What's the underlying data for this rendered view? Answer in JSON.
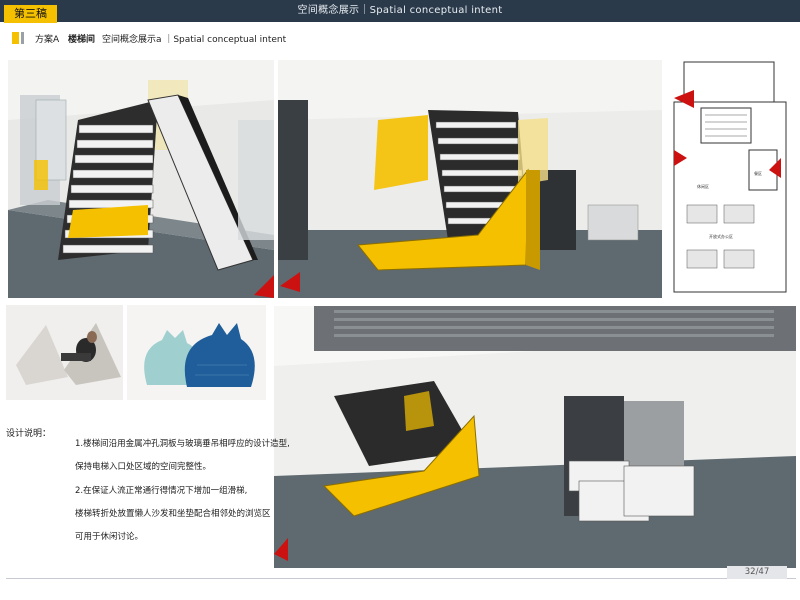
{
  "header": {
    "badge": "第三稿",
    "title": "空间概念展示｜Spatial  conceptual  intent"
  },
  "subheader": {
    "scheme": "方案A",
    "section": "楼梯间",
    "caption": "空间概念展示a ｜Spatial  conceptual  intent"
  },
  "description": {
    "heading": "设计说明：",
    "lines": [
      "1.楼梯间沿用金属冲孔洞板与玻璃垂吊相呼应的设计造型,",
      "保持电梯入口处区域的空间完整性。",
      "2.在保证人流正常通行得情况下增加一组滑梯,",
      "楼梯转折处放置懒人沙发和坐垫配合相邻处的浏览区",
      "可用于休闲讨论。"
    ]
  },
  "plan_labels": {
    "lounge": "休闲区",
    "dining": "餐区",
    "office": "开放式办公区"
  },
  "colors": {
    "accent_yellow": "#f5c000",
    "header_bg": "#2b3a4a",
    "marker_red": "#cc1111",
    "floor_gray": "#5f6a70"
  },
  "footer": {
    "page": "32/47"
  }
}
